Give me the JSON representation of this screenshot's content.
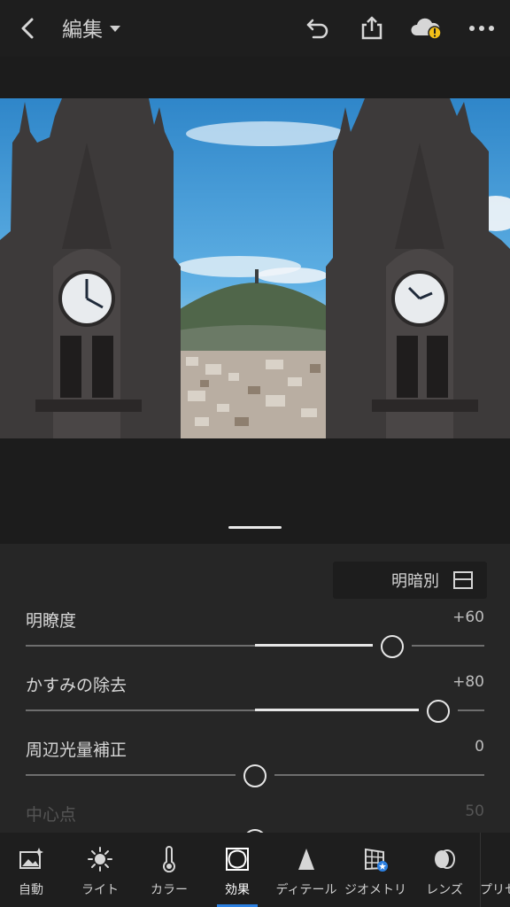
{
  "header": {
    "title": "編集"
  },
  "panel": {
    "mode_button_label": "明暗別",
    "sliders": [
      {
        "name": "明瞭度",
        "value_text": "+60",
        "value": 60,
        "min": -100,
        "max": 100
      },
      {
        "name": "かすみの除去",
        "value_text": "+80",
        "value": 80,
        "min": -100,
        "max": 100
      },
      {
        "name": "周辺光量補正",
        "value_text": "0",
        "value": 0,
        "min": -100,
        "max": 100
      },
      {
        "name": "中心点",
        "value_text": "50",
        "value": 50,
        "min": 0,
        "max": 100
      }
    ]
  },
  "toolbar": {
    "items": [
      {
        "label": "自動",
        "icon": "auto-image-icon",
        "active": false
      },
      {
        "label": "ライト",
        "icon": "sun-icon",
        "active": false
      },
      {
        "label": "カラー",
        "icon": "thermometer-icon",
        "active": false
      },
      {
        "label": "効果",
        "icon": "effects-frame-icon",
        "active": true
      },
      {
        "label": "ディテール",
        "icon": "triangle-icon",
        "active": false
      },
      {
        "label": "ジオメトリ",
        "icon": "geometry-grid-icon",
        "active": false
      },
      {
        "label": "レンズ",
        "icon": "lens-icon",
        "active": false
      },
      {
        "label": "プリセ",
        "icon": "preset-circles-icon",
        "active": false
      }
    ]
  },
  "colors": {
    "accent": "#2b7fe0",
    "warning_badge": "#f3c019",
    "panel_bg": "#262626"
  }
}
